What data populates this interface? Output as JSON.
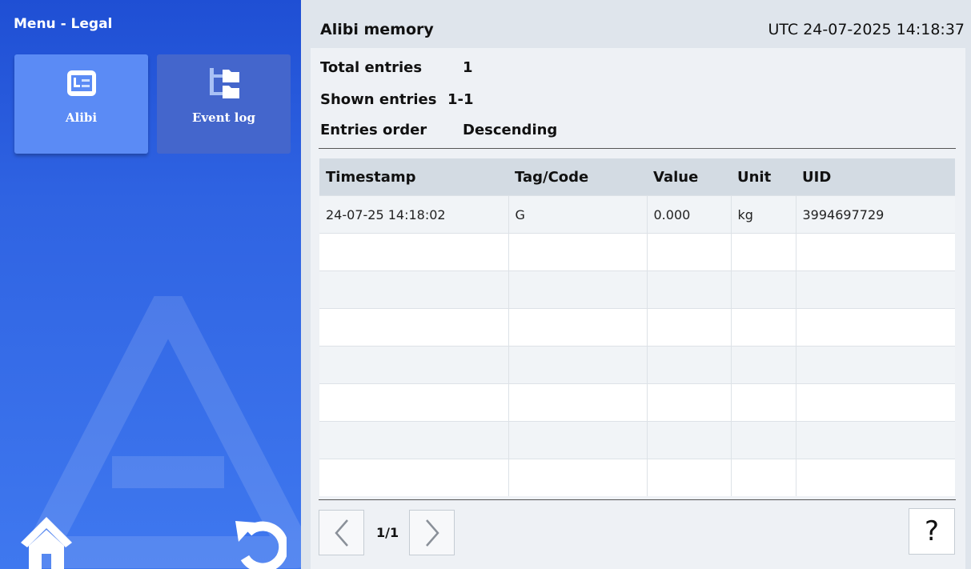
{
  "sidebar": {
    "title": "Menu - Legal",
    "items": [
      {
        "label": "Alibi",
        "icon": "alibi-list-icon",
        "active": true
      },
      {
        "label": "Event log",
        "icon": "folder-tree-icon",
        "active": false
      }
    ],
    "home_icon": "home-icon",
    "back_icon": "back-icon"
  },
  "header": {
    "title": "Alibi memory",
    "datetime": "UTC 24-07-2025 14:18:37"
  },
  "summary": {
    "total_label": "Total entries",
    "total_value": "1",
    "shown_label": "Shown entries",
    "shown_value": "1-1",
    "order_label": "Entries order",
    "order_value": "Descending"
  },
  "table": {
    "columns": [
      "Timestamp",
      "Tag/Code",
      "Value",
      "Unit",
      "UID"
    ],
    "rows": [
      {
        "timestamp": "24-07-25 14:18:02",
        "tag": "G",
        "value": "0.000",
        "unit": "kg",
        "uid": "3994697729"
      }
    ]
  },
  "pagination": {
    "page": "1/1",
    "prev_icon": "chevron-left-icon",
    "next_icon": "chevron-right-icon"
  },
  "help_label": "?",
  "colors": {
    "sidebar_top": "#1f4fd4",
    "sidebar_bottom": "#3f78ef",
    "tile_active": "#5b8bf5",
    "tile_inactive": "#4466cc",
    "panel_bg": "#eef1f5",
    "table_header": "#d3dbe3"
  }
}
